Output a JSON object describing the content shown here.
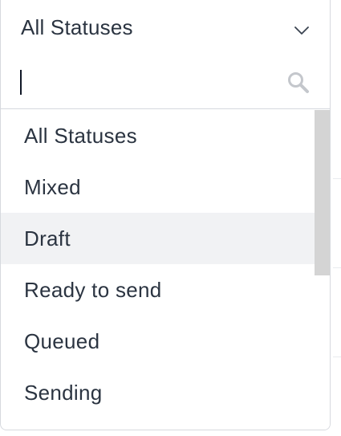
{
  "select": {
    "selected_label": "All Statuses",
    "chevron_icon": "chevron-down-icon"
  },
  "search": {
    "value": "",
    "placeholder": "",
    "icon": "search-icon"
  },
  "options": [
    {
      "label": "All Statuses"
    },
    {
      "label": "Mixed"
    },
    {
      "label": "Draft",
      "highlighted": true
    },
    {
      "label": "Ready to send"
    },
    {
      "label": "Queued"
    },
    {
      "label": "Sending"
    }
  ],
  "colors": {
    "text": "#2b3441",
    "border": "#d6d9de",
    "highlight_bg": "#f1f2f4",
    "scrollbar_thumb": "#d4d4d4",
    "icon": "#c4c7cc"
  }
}
